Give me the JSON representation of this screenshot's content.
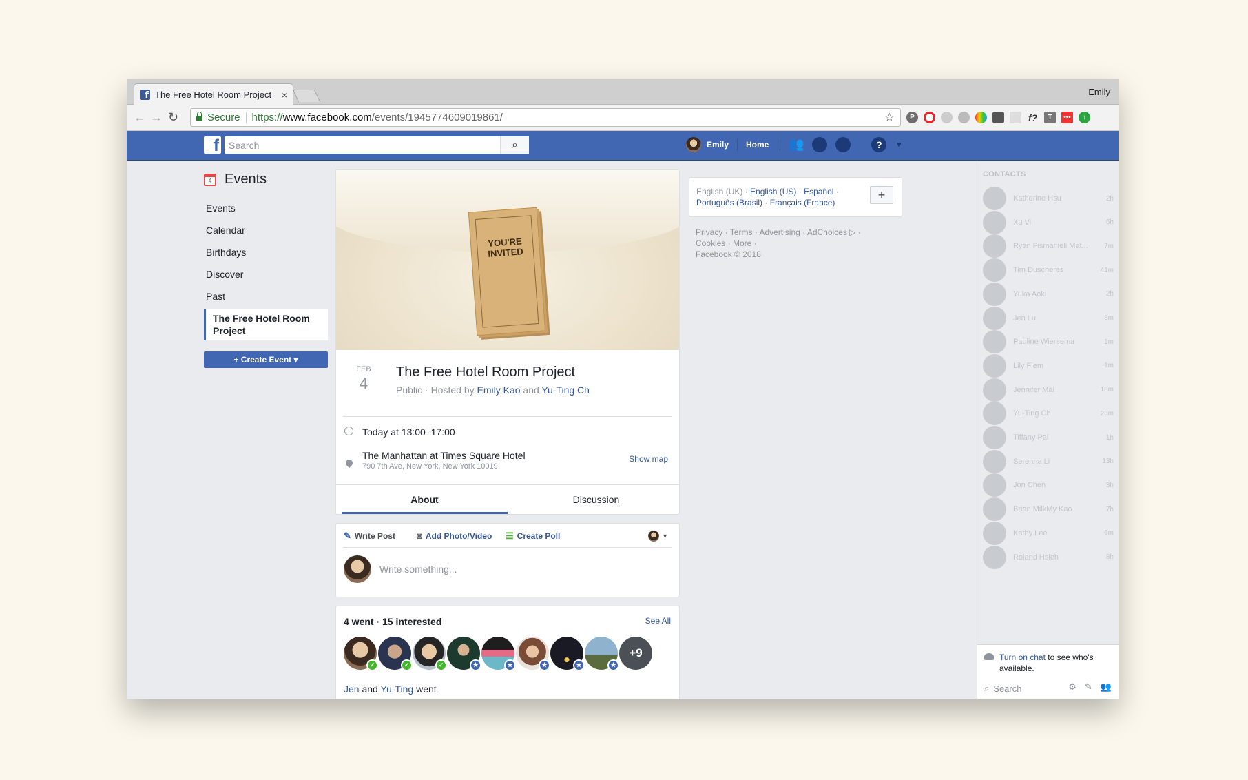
{
  "browser": {
    "tab_title": "The Free Hotel Room Project",
    "tab_close": "×",
    "profile": "Emily",
    "secure_label": "Secure",
    "url_scheme": "https://",
    "url_host": "www.facebook.com",
    "url_path": "/events/1945774609019861/"
  },
  "fb": {
    "search_placeholder": "Search",
    "user_name": "Emily",
    "home_label": "Home"
  },
  "sidebar": {
    "title": "Events",
    "calendar_day": "4",
    "items": [
      "Events",
      "Calendar",
      "Birthdays",
      "Discover",
      "Past"
    ],
    "active_item": "The Free Hotel Room Project",
    "create_label": "+ Create Event ▾"
  },
  "event": {
    "invite_text": "YOU'RE INVITED",
    "month": "FEB",
    "day": "4",
    "title": "The Free Hotel Room Project",
    "privacy": "Public · Hosted by",
    "host1": "Emily Kao",
    "and": "and",
    "host2": "Yu-Ting Ch",
    "time": "Today at 13:00–17:00",
    "venue": "The Manhattan at Times Square Hotel",
    "address": "790 7th Ave, New York, New York 10019",
    "show_map": "Show map"
  },
  "tabs": {
    "about": "About",
    "discussion": "Discussion"
  },
  "composer": {
    "write_post": "Write Post",
    "add_photo": "Add Photo/Video",
    "create_poll": "Create Poll",
    "placeholder": "Write something..."
  },
  "going": {
    "summary": "4 went · 15 interested",
    "see_all": "See All",
    "more_count": "+9",
    "footer_name1": "Jen",
    "footer_and": "and",
    "footer_name2": "Yu-Ting",
    "footer_went": "went"
  },
  "right": {
    "lang1": "English (UK)",
    "lang2": "English (US)",
    "lang3": "Español",
    "lang4": "Português (Brasil)",
    "lang5": "Français (France)",
    "footer_line1": "Privacy · Terms · Advertising · AdChoices ▷ ·",
    "footer_line2": "Cookies · More ·",
    "footer_line3": "Facebook © 2018"
  },
  "chat": {
    "header": "CONTACTS",
    "contacts": [
      {
        "name": "Katherine Hsu",
        "time": "2h"
      },
      {
        "name": "Xu Vi",
        "time": "6h"
      },
      {
        "name": "Ryan Fismanleli Mat...",
        "time": "7m"
      },
      {
        "name": "Tim Duscheres",
        "time": "41m"
      },
      {
        "name": "Yuka Aoki",
        "time": "2h"
      },
      {
        "name": "Jen Lu",
        "time": "8m"
      },
      {
        "name": "Pauline Wiersema",
        "time": "1m"
      },
      {
        "name": "Lily Fiem",
        "time": "1m"
      },
      {
        "name": "Jennifer Mai",
        "time": "18m"
      },
      {
        "name": "Yu-Ting Ch",
        "time": "23m"
      },
      {
        "name": "Tiffany Pai",
        "time": "1h"
      },
      {
        "name": "Serenna Li",
        "time": "13h"
      },
      {
        "name": "Jon Chen",
        "time": "3h"
      },
      {
        "name": "Brian MilkMy Kao",
        "time": "7h"
      },
      {
        "name": "Kathy Lee",
        "time": "6m"
      },
      {
        "name": "Roland Hsieh",
        "time": "8h"
      }
    ],
    "turn_on_link": "Turn on chat",
    "turn_on_rest": "to see who's available.",
    "search_placeholder": "Search"
  },
  "colors": {
    "fb_blue": "#4267b2",
    "link": "#365899",
    "went_badge": "#42b72a",
    "interested_badge": "#4267b2"
  }
}
